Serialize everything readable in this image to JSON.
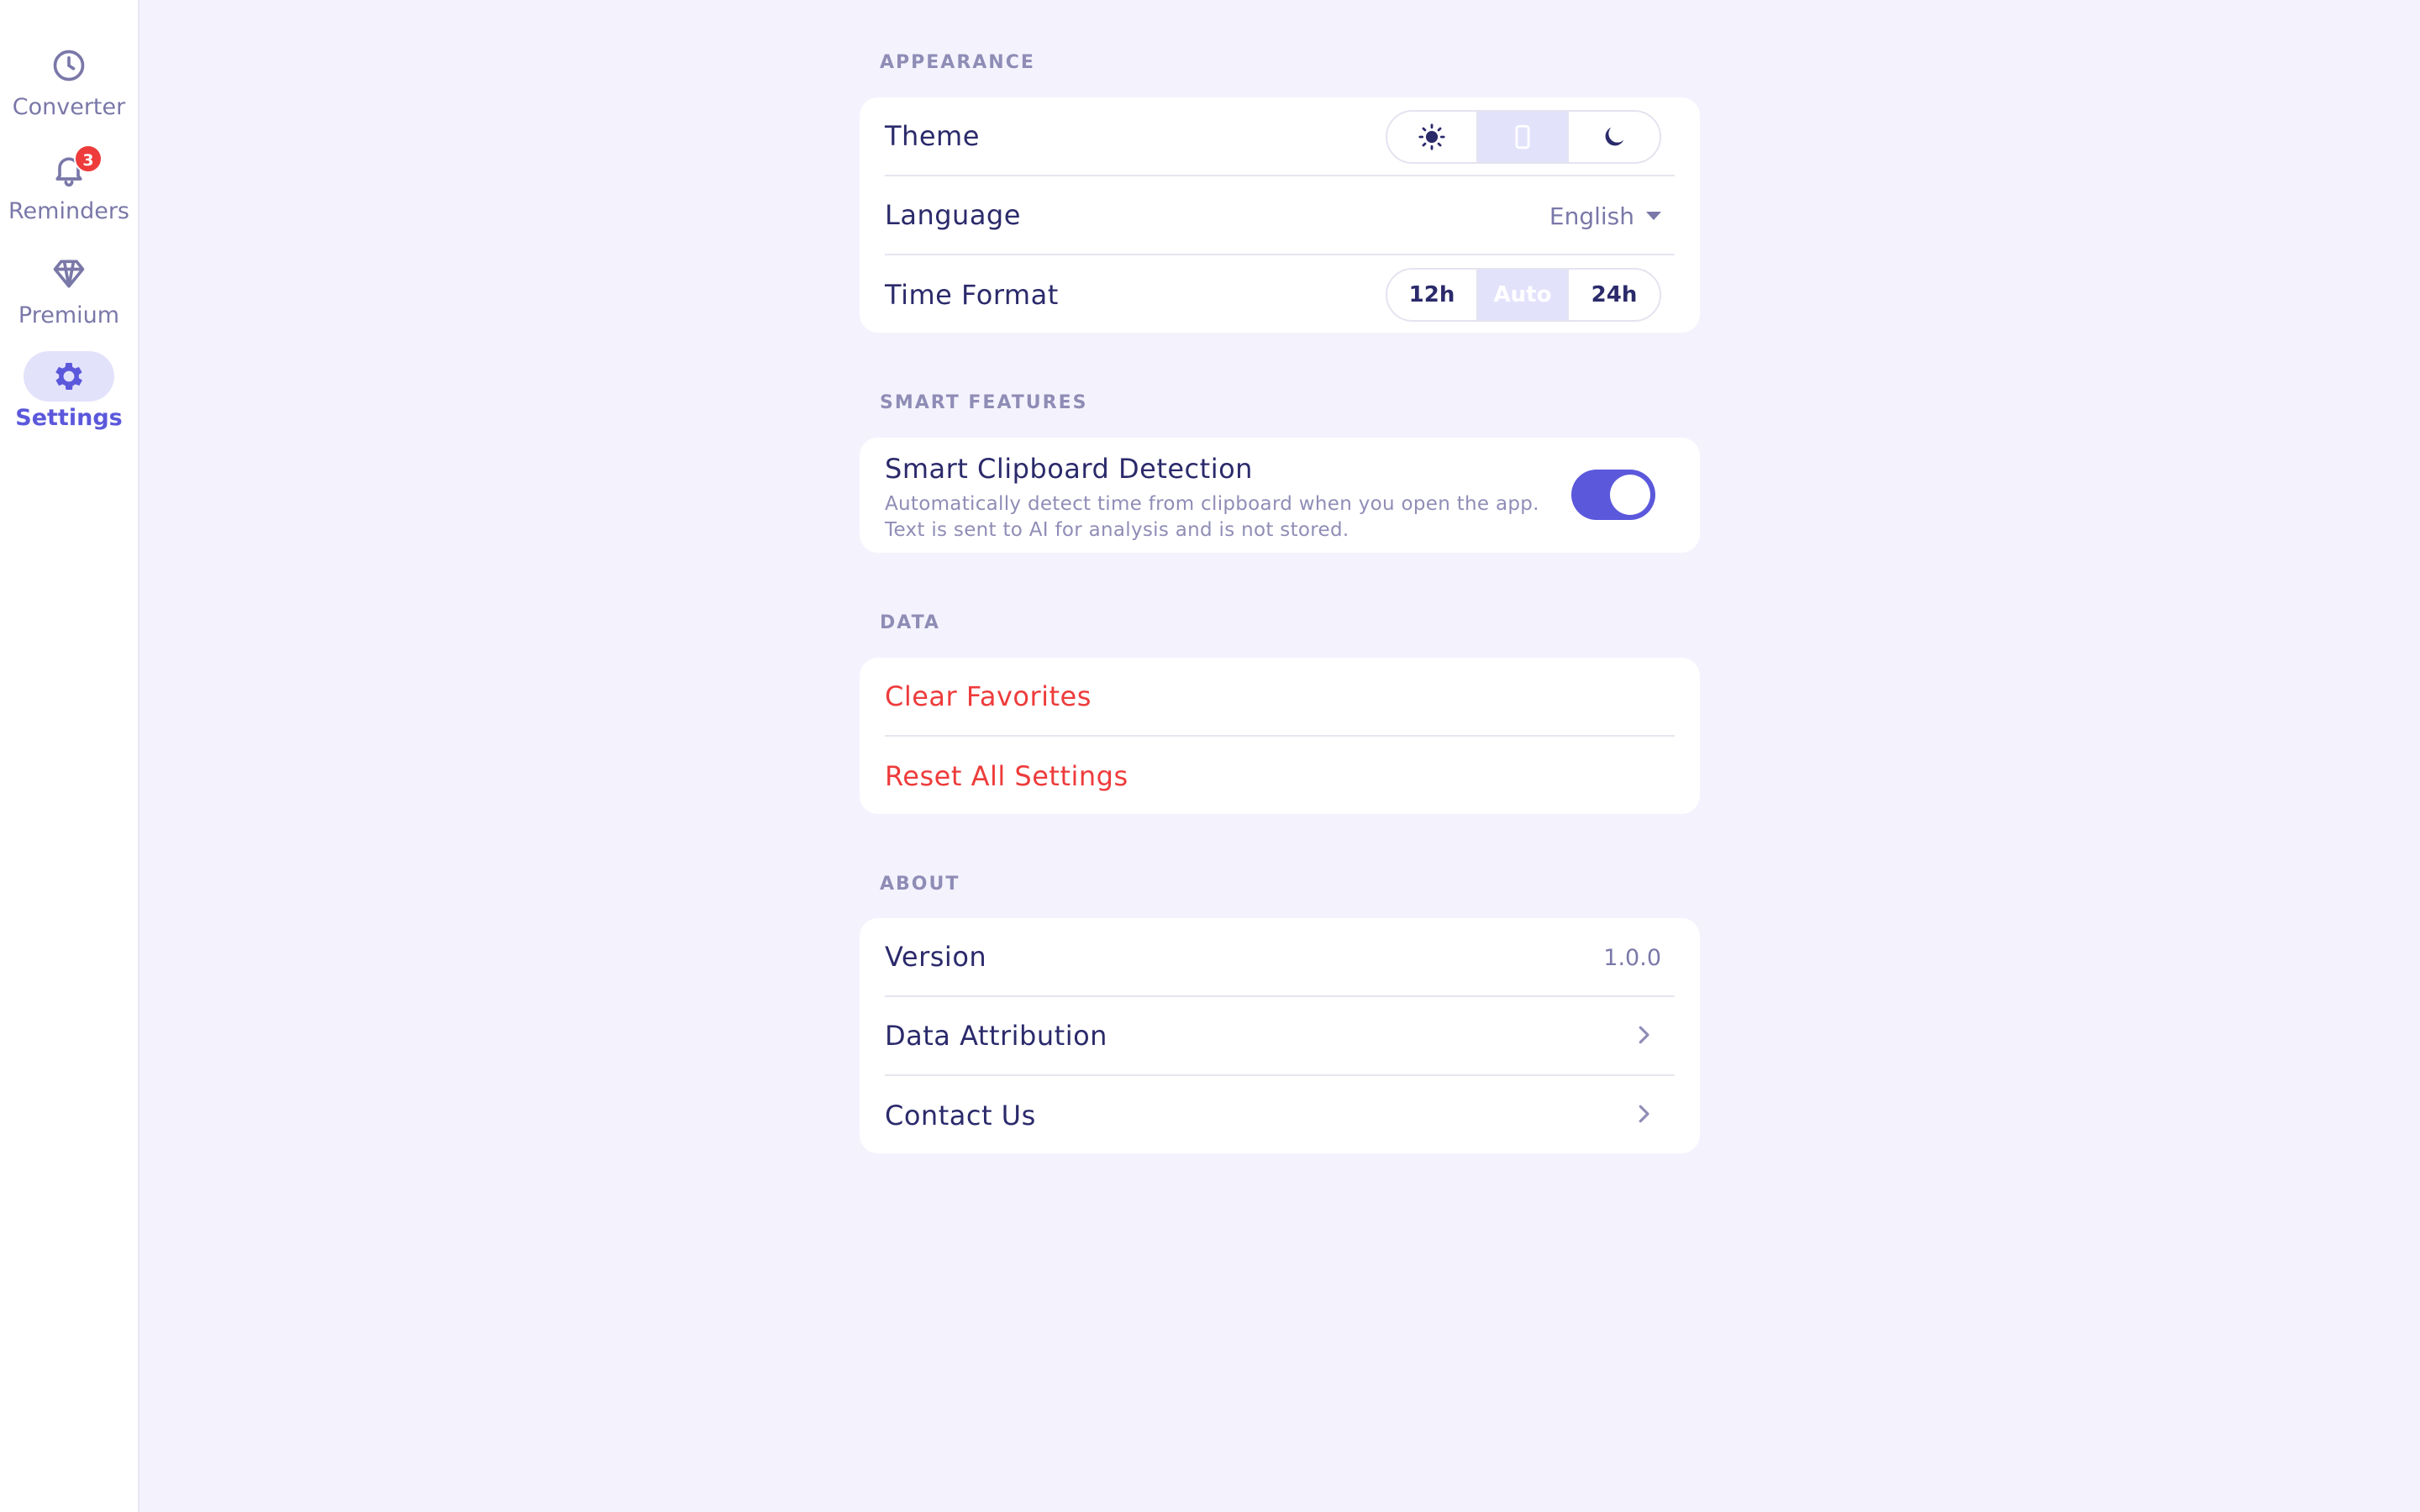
{
  "sidebar": {
    "items": [
      {
        "label": "Converter",
        "icon": "clock-icon"
      },
      {
        "label": "Reminders",
        "icon": "bell-icon",
        "badge": "3"
      },
      {
        "label": "Premium",
        "icon": "diamond-icon"
      },
      {
        "label": "Settings",
        "icon": "gear-icon",
        "active": true
      }
    ]
  },
  "appearance": {
    "title": "APPEARANCE",
    "theme_label": "Theme",
    "theme_options": [
      "sun-icon",
      "phone-icon",
      "moon-icon"
    ],
    "theme_selected": "phone-icon",
    "language_label": "Language",
    "language_value": "English",
    "time_format_label": "Time Format",
    "time_format_options": [
      "12h",
      "Auto",
      "24h"
    ],
    "time_format_selected": "Auto"
  },
  "smart_features": {
    "title": "SMART FEATURES",
    "clipboard_label": "Smart Clipboard Detection",
    "clipboard_desc_1": "Automatically detect time from clipboard when you open the app.",
    "clipboard_desc_2": "Text is sent to AI for analysis and is not stored.",
    "clipboard_enabled": true
  },
  "data_section": {
    "title": "DATA",
    "clear_favorites": "Clear Favorites",
    "reset_all": "Reset All Settings"
  },
  "about": {
    "title": "ABOUT",
    "version_label": "Version",
    "version_value": "1.0.0",
    "attribution_label": "Data Attribution",
    "contact_label": "Contact Us"
  },
  "colors": {
    "accent": "#5b58dc",
    "danger": "#ee3b3b",
    "background": "#f4f3fd"
  }
}
